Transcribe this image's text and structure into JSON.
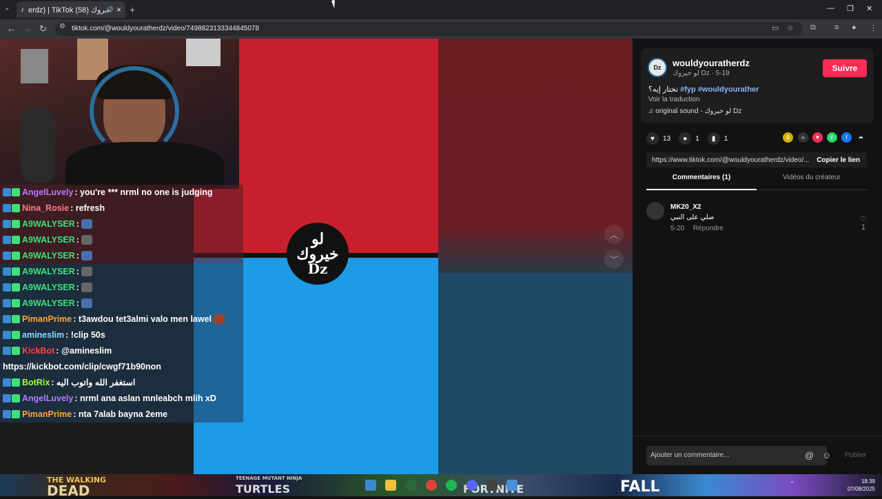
{
  "browser": {
    "tab_title": "erdz) | TikTok لو خيروك (58)",
    "tab_icon": "tiktok-icon",
    "url": "tiktok.com/@wouldyouratherdz/video/7498823133344845078"
  },
  "video": {
    "logo_line1": "لو",
    "logo_line2": "خيروك",
    "logo_line3": "Dz",
    "colors": {
      "top": "#c8202c",
      "bottom": "#1e9ae6"
    }
  },
  "chat": [
    {
      "user": "AngelLuvely",
      "user_color": "#b07cff",
      "text": ": you're *** nrml no one is judging",
      "bg": "bgr"
    },
    {
      "user": "Nina_Rosie",
      "user_color": "#ff7a8a",
      "text": ": refresh",
      "bg": "bgr"
    },
    {
      "user": "A9WALYSER",
      "user_color": "#3fe07a",
      "text": ":",
      "emote": "#4a6fb0",
      "bg": "bgr"
    },
    {
      "user": "A9WALYSER",
      "user_color": "#3fe07a",
      "text": ":",
      "emote": "#666",
      "bg": "bgr"
    },
    {
      "user": "A9WALYSER",
      "user_color": "#3fe07a",
      "text": ":",
      "emote": "#4a6fb0",
      "bg": "bgr"
    },
    {
      "user": "A9WALYSER",
      "user_color": "#3fe07a",
      "text": ":",
      "emote": "#666",
      "bg": "bg"
    },
    {
      "user": "A9WALYSER",
      "user_color": "#3fe07a",
      "text": ":",
      "emote": "#666",
      "bg": "bg"
    },
    {
      "user": "A9WALYSER",
      "user_color": "#3fe07a",
      "text": ":",
      "emote": "#4a6fb0",
      "bg": "bg"
    },
    {
      "user": "PimanPrime",
      "user_color": "#ffa53a",
      "text": ": t3awdou tet3almi valo men lawel",
      "emote": "#a04030",
      "bg": "bg"
    },
    {
      "user": "amineslim",
      "user_color": "#8ad8ff",
      "text": ": !clip 50s",
      "bg": "bg"
    },
    {
      "user": "KickBot",
      "user_color": "#ff4444",
      "text": ": @amineslim",
      "bg": "bg"
    },
    {
      "user": "",
      "user_color": "#fff",
      "text": "https://kickbot.com/clip/cwgf71b90non",
      "bg": "bg"
    },
    {
      "user": "BotRix",
      "user_color": "#a0ff40",
      "text": ": استغفر الله واتوب اليه",
      "bg": "bg"
    },
    {
      "user": "AngelLuvely",
      "user_color": "#b07cff",
      "text": ": nrml ana aslan mnleabch mlih xD",
      "bg": "bg"
    },
    {
      "user": "PimanPrime",
      "user_color": "#ffa53a",
      "text": ": nta 7alab bayna 2eme",
      "bg": "bg"
    }
  ],
  "panel": {
    "username": "wouldyouratherdz",
    "subline": "لو خيروك Dz · 5-19",
    "follow_label": "Suivre",
    "desc_prefix": "تختار إيه؟",
    "tag1": "#fyp",
    "tag2": "#wouldyourather",
    "translate": "Voir la traduction",
    "sound": "♫ original sound - لو خيروك Dz",
    "likes": "13",
    "comments": "1",
    "saves": "1",
    "link": "https://www.tiktok.com/@wouldyouratherdz/video/...",
    "copy_label": "Copier le lien",
    "tab_comments": "Commentaires (1)",
    "tab_videos": "Vidéos du créateur",
    "comment": {
      "user": "MK20_X2",
      "text": "صلي على النبي",
      "date": "5-20",
      "reply": "Répondre",
      "likes": "1"
    },
    "add_comment_placeholder": "Ajouter un commentaire...",
    "publish_label": "Publier"
  },
  "taskbar": {
    "time": "18:39",
    "date": "07/08/2025",
    "game1": "THE WALKING",
    "game1b": "DEAD",
    "game2": "TEENAGE MUTANT NINJA",
    "game2b": "TURTLES",
    "game3": "FORTNITE",
    "game4": "FALL"
  }
}
